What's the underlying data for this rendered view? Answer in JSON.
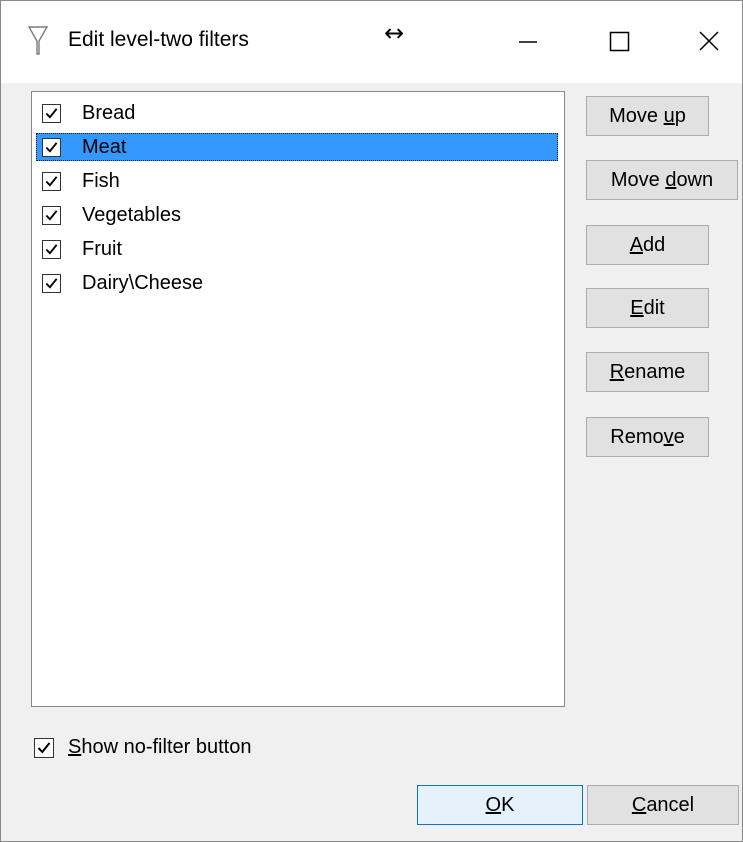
{
  "window": {
    "title": "Edit level-two filters",
    "resize_cursor": "↔",
    "title_icon": "filter-funnel-icon"
  },
  "filters": {
    "items": [
      {
        "label": "Bread",
        "checked": true,
        "selected": false
      },
      {
        "label": "Meat",
        "checked": true,
        "selected": true
      },
      {
        "label": "Fish",
        "checked": true,
        "selected": false
      },
      {
        "label": "Vegetables",
        "checked": true,
        "selected": false
      },
      {
        "label": "Fruit",
        "checked": true,
        "selected": false
      },
      {
        "label": "Dairy\\Cheese",
        "checked": true,
        "selected": false
      }
    ]
  },
  "buttons": {
    "move_up": {
      "pre": "Move ",
      "mnemonic": "u",
      "post": "p"
    },
    "move_down": {
      "pre": "Move ",
      "mnemonic": "d",
      "post": "own"
    },
    "add": {
      "pre": "",
      "mnemonic": "A",
      "post": "dd"
    },
    "edit": {
      "pre": "",
      "mnemonic": "E",
      "post": "dit"
    },
    "rename": {
      "pre": "",
      "mnemonic": "R",
      "post": "ename"
    },
    "remove": {
      "pre": "Remo",
      "mnemonic": "v",
      "post": "e"
    },
    "ok": {
      "pre": "",
      "mnemonic": "O",
      "post": "K"
    },
    "cancel": {
      "pre": "",
      "mnemonic": "C",
      "post": "ancel"
    }
  },
  "show_no_filter": {
    "pre": "",
    "mnemonic": "S",
    "post": "how no-filter button",
    "checked": true
  },
  "colors": {
    "selection": "#3399ff",
    "window_bg": "#f0f0f0",
    "default_button_border": "#0078d7"
  }
}
